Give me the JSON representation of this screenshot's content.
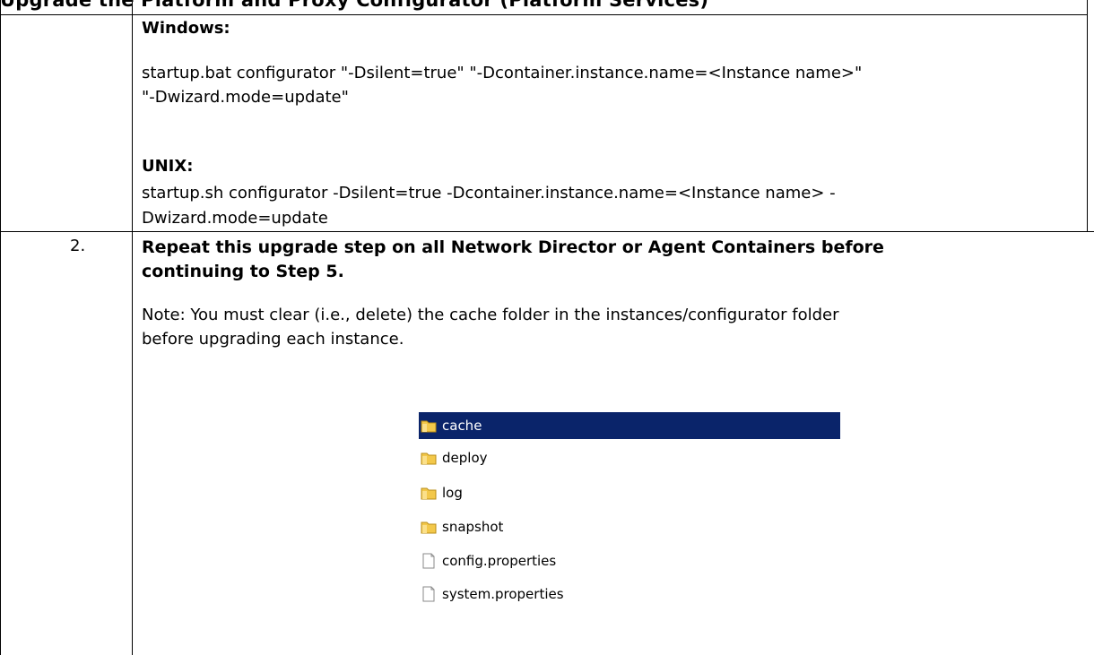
{
  "heading": "Upgrade the Platform and Proxy Configurator (Platform Services)",
  "row1": {
    "windows_label": "Windows:",
    "windows_line1": "startup.bat configurator \"-Dsilent=true\" \"-Dcontainer.instance.name=<Instance name>\"",
    "windows_line2": "\"-Dwizard.mode=update\"",
    "unix_label": "UNIX:",
    "unix_line1": "startup.sh configurator -Dsilent=true -Dcontainer.instance.name=<Instance name> -",
    "unix_line2": "Dwizard.mode=update"
  },
  "row2": {
    "number": "2.",
    "title_line1": "Repeat this upgrade step on all Network Director or Agent Containers before",
    "title_line2": "continuing to Step 5.",
    "note_line1": "Note: You must clear (i.e., delete) the cache folder in the instances/configurator folder",
    "note_line2": "before upgrading each instance."
  },
  "explorer": {
    "items": [
      {
        "name": "cache",
        "icon": "folder-icon",
        "selected": true
      },
      {
        "name": "deploy",
        "icon": "folder-icon",
        "selected": false
      },
      {
        "name": "log",
        "icon": "folder-icon",
        "selected": false
      },
      {
        "name": "snapshot",
        "icon": "folder-icon",
        "selected": false
      },
      {
        "name": "config.properties",
        "icon": "file-icon",
        "selected": false
      },
      {
        "name": "system.properties",
        "icon": "file-icon",
        "selected": false
      }
    ],
    "selection_color": "#0a246a"
  }
}
